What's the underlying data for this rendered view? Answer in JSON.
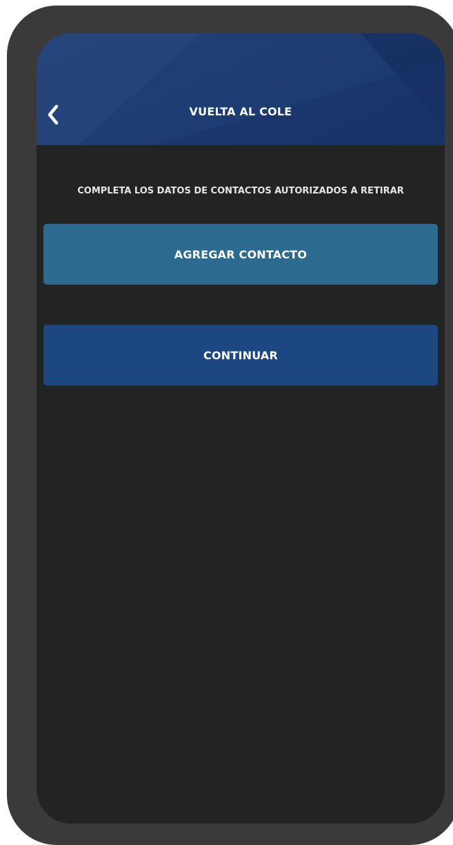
{
  "header": {
    "title": "VUELTA AL COLE",
    "back_icon": "chevron-left-icon"
  },
  "main": {
    "instruction": "COMPLETA LOS DATOS DE CONTACTOS AUTORIZADOS A RETIRAR",
    "add_contact_label": "AGREGAR CONTACTO",
    "continue_label": "CONTINUAR"
  },
  "colors": {
    "header_blue": "#1d3a6e",
    "screen_background": "#222323",
    "add_contact_button": "#2c6a8f",
    "continue_button": "#1c4780",
    "device_frame": "#3a3a3a"
  }
}
